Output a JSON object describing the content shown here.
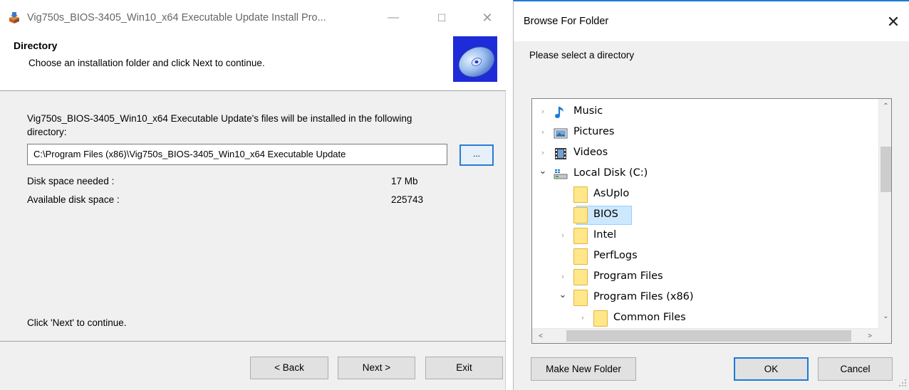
{
  "installer": {
    "title": "Vig750s_BIOS-3405_Win10_x64 Executable Update Install Pro...",
    "minimize_glyph": "—",
    "maximize_glyph": "☐",
    "close_glyph": "✕",
    "heading": "Directory",
    "subheading": "Choose an installation folder and click Next to continue.",
    "description_line1": "Vig750s_BIOS-3405_Win10_x64 Executable Update's files will be installed in the following",
    "description_line2": "directory:",
    "directory_value": "C:\\Program Files (x86)\\Vig750s_BIOS-3405_Win10_x64 Executable Update",
    "browse_label": "...",
    "disk_needed_label": "Disk space needed :",
    "disk_needed_value": "17 Mb",
    "disk_available_label": "Available disk space :",
    "disk_available_value": "225743",
    "hint": "Click 'Next' to continue.",
    "back_label": "< Back",
    "next_label": "Next >",
    "exit_label": "Exit",
    "header_icon": "cd-disc-icon",
    "app_icon": "installer-box-icon"
  },
  "browse_dialog": {
    "title": "Browse For Folder",
    "close_glyph": "✕",
    "message": "Please select a directory",
    "tree": [
      {
        "label": "Music",
        "expander": "›",
        "icon": "music-note-icon"
      },
      {
        "label": "Pictures",
        "expander": "›",
        "icon": "pictures-icon"
      },
      {
        "label": "Videos",
        "expander": "›",
        "icon": "videos-icon"
      },
      {
        "label": "Local Disk (C:)",
        "expander": "⌄",
        "icon": "local-disk-icon"
      },
      {
        "label": "AsUplo",
        "expander": "",
        "icon": "folder-icon"
      },
      {
        "label": "BIOS",
        "expander": "",
        "icon": "folder-icon",
        "selected": true
      },
      {
        "label": "Intel",
        "expander": "›",
        "icon": "folder-icon"
      },
      {
        "label": "PerfLogs",
        "expander": "",
        "icon": "folder-icon"
      },
      {
        "label": "Program Files",
        "expander": "›",
        "icon": "folder-icon"
      },
      {
        "label": "Program Files (x86)",
        "expander": "⌄",
        "icon": "folder-icon"
      },
      {
        "label": "Common Files",
        "expander": "›",
        "icon": "folder-icon"
      }
    ],
    "scroll_up_glyph": "⌃",
    "scroll_down_glyph": "⌄",
    "scroll_left_glyph": "<",
    "scroll_right_glyph": ">",
    "make_new_folder_label": "Make New Folder",
    "ok_label": "OK",
    "cancel_label": "Cancel",
    "accent_color": "#1b7ad6",
    "selection_color": "#cce8ff"
  }
}
